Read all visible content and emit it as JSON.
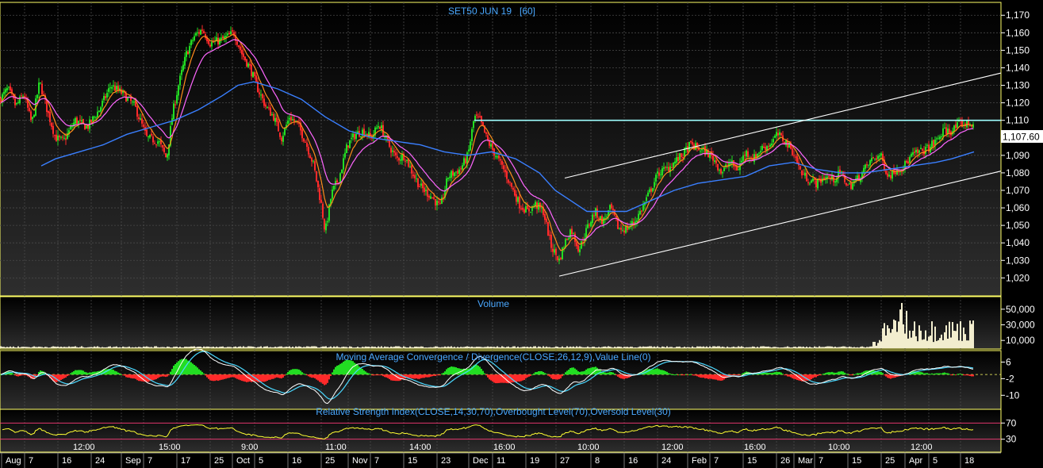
{
  "chart_data": {
    "type": "candlestick",
    "title": "SET50 JUN 19   [60]",
    "last_price_label": "1,107.60",
    "last_price": 1107.6,
    "price_axis": {
      "ylim": [
        1012,
        1176
      ],
      "ticks": [
        {
          "v": 1170,
          "label": "1,170"
        },
        {
          "v": 1160,
          "label": "1,160"
        },
        {
          "v": 1150,
          "label": "1,150"
        },
        {
          "v": 1140,
          "label": "1,140"
        },
        {
          "v": 1130,
          "label": "1,130"
        },
        {
          "v": 1120,
          "label": "1,120"
        },
        {
          "v": 1110,
          "label": "1,110"
        },
        {
          "v": 1090,
          "label": "1,090"
        },
        {
          "v": 1080,
          "label": "1,080"
        },
        {
          "v": 1070,
          "label": "1,070"
        },
        {
          "v": 1060,
          "label": "1,060"
        },
        {
          "v": 1050,
          "label": "1,050"
        },
        {
          "v": 1040,
          "label": "1,040"
        },
        {
          "v": 1030,
          "label": "1,030"
        },
        {
          "v": 1020,
          "label": "1,020"
        }
      ]
    },
    "price_path": [
      [
        0,
        1122
      ],
      [
        10,
        1128
      ],
      [
        20,
        1118
      ],
      [
        30,
        1125
      ],
      [
        40,
        1108
      ],
      [
        50,
        1132
      ],
      [
        60,
        1115
      ],
      [
        70,
        1100
      ],
      [
        80,
        1098
      ],
      [
        95,
        1110
      ],
      [
        110,
        1106
      ],
      [
        125,
        1116
      ],
      [
        140,
        1130
      ],
      [
        155,
        1125
      ],
      [
        170,
        1118
      ],
      [
        185,
        1100
      ],
      [
        200,
        1098
      ],
      [
        210,
        1088
      ],
      [
        218,
        1115
      ],
      [
        225,
        1130
      ],
      [
        235,
        1148
      ],
      [
        245,
        1158
      ],
      [
        255,
        1162
      ],
      [
        265,
        1154
      ],
      [
        280,
        1156
      ],
      [
        295,
        1160
      ],
      [
        305,
        1148
      ],
      [
        315,
        1140
      ],
      [
        325,
        1128
      ],
      [
        335,
        1118
      ],
      [
        345,
        1112
      ],
      [
        355,
        1100
      ],
      [
        365,
        1112
      ],
      [
        375,
        1108
      ],
      [
        385,
        1098
      ],
      [
        395,
        1085
      ],
      [
        405,
        1062
      ],
      [
        410,
        1046
      ],
      [
        418,
        1068
      ],
      [
        428,
        1078
      ],
      [
        438,
        1096
      ],
      [
        448,
        1102
      ],
      [
        458,
        1104
      ],
      [
        468,
        1100
      ],
      [
        478,
        1108
      ],
      [
        490,
        1096
      ],
      [
        500,
        1088
      ],
      [
        510,
        1090
      ],
      [
        520,
        1080
      ],
      [
        530,
        1072
      ],
      [
        545,
        1066
      ],
      [
        555,
        1060
      ],
      [
        565,
        1078
      ],
      [
        580,
        1082
      ],
      [
        590,
        1090
      ],
      [
        598,
        1112
      ],
      [
        605,
        1110
      ],
      [
        615,
        1098
      ],
      [
        625,
        1090
      ],
      [
        635,
        1082
      ],
      [
        645,
        1072
      ],
      [
        655,
        1062
      ],
      [
        665,
        1058
      ],
      [
        675,
        1062
      ],
      [
        685,
        1058
      ],
      [
        695,
        1038
      ],
      [
        705,
        1030
      ],
      [
        712,
        1040
      ],
      [
        720,
        1048
      ],
      [
        730,
        1036
      ],
      [
        740,
        1048
      ],
      [
        750,
        1058
      ],
      [
        760,
        1052
      ],
      [
        770,
        1060
      ],
      [
        780,
        1048
      ],
      [
        790,
        1048
      ],
      [
        800,
        1052
      ],
      [
        810,
        1060
      ],
      [
        820,
        1070
      ],
      [
        830,
        1080
      ],
      [
        840,
        1082
      ],
      [
        850,
        1086
      ],
      [
        860,
        1090
      ],
      [
        870,
        1096
      ],
      [
        880,
        1094
      ],
      [
        890,
        1092
      ],
      [
        900,
        1088
      ],
      [
        910,
        1080
      ],
      [
        920,
        1086
      ],
      [
        930,
        1082
      ],
      [
        940,
        1092
      ],
      [
        950,
        1088
      ],
      [
        960,
        1094
      ],
      [
        970,
        1096
      ],
      [
        980,
        1102
      ],
      [
        990,
        1098
      ],
      [
        1000,
        1092
      ],
      [
        1010,
        1080
      ],
      [
        1020,
        1076
      ],
      [
        1030,
        1074
      ],
      [
        1040,
        1078
      ],
      [
        1050,
        1076
      ],
      [
        1060,
        1080
      ],
      [
        1070,
        1072
      ],
      [
        1080,
        1076
      ],
      [
        1090,
        1082
      ],
      [
        1100,
        1088
      ],
      [
        1110,
        1090
      ],
      [
        1120,
        1078
      ],
      [
        1130,
        1082
      ],
      [
        1140,
        1084
      ],
      [
        1150,
        1090
      ],
      [
        1160,
        1092
      ],
      [
        1170,
        1094
      ],
      [
        1180,
        1098
      ],
      [
        1190,
        1104
      ],
      [
        1200,
        1104
      ],
      [
        1210,
        1108
      ],
      [
        1220,
        1108
      ],
      [
        1228,
        1108
      ]
    ],
    "series": [
      {
        "name": "EMA fast",
        "color": "#ff8c1a"
      },
      {
        "name": "EMA mid",
        "color": "#ff66ff"
      },
      {
        "name": "EMA slow",
        "color": "#3a7fff",
        "path": [
          [
            52,
            1084
          ],
          [
            70,
            1088
          ],
          [
            100,
            1092
          ],
          [
            130,
            1096
          ],
          [
            160,
            1102
          ],
          [
            190,
            1106
          ],
          [
            220,
            1110
          ],
          [
            250,
            1116
          ],
          [
            280,
            1124
          ],
          [
            300,
            1130
          ],
          [
            320,
            1132
          ],
          [
            350,
            1128
          ],
          [
            380,
            1122
          ],
          [
            410,
            1112
          ],
          [
            440,
            1104
          ],
          [
            470,
            1100
          ],
          [
            500,
            1098
          ],
          [
            530,
            1096
          ],
          [
            560,
            1092
          ],
          [
            590,
            1090
          ],
          [
            620,
            1092
          ],
          [
            650,
            1088
          ],
          [
            680,
            1080
          ],
          [
            700,
            1070
          ],
          [
            720,
            1064
          ],
          [
            740,
            1058
          ],
          [
            760,
            1058
          ],
          [
            790,
            1058
          ],
          [
            820,
            1064
          ],
          [
            850,
            1070
          ],
          [
            880,
            1074
          ],
          [
            910,
            1076
          ],
          [
            940,
            1078
          ],
          [
            970,
            1084
          ],
          [
            1000,
            1086
          ],
          [
            1030,
            1082
          ],
          [
            1060,
            1080
          ],
          [
            1090,
            1080
          ],
          [
            1120,
            1082
          ],
          [
            1150,
            1084
          ],
          [
            1180,
            1086
          ],
          [
            1200,
            1088
          ],
          [
            1228,
            1092
          ]
        ]
      }
    ],
    "annotations": {
      "resistance": {
        "value": 1110,
        "x_start": 598,
        "x_end": 1262
      },
      "upper_channel": [
        [
          712,
          1077
        ],
        [
          1262,
          1137
        ]
      ],
      "lower_channel": [
        [
          705,
          1021
        ],
        [
          1262,
          1081
        ]
      ]
    },
    "volume": {
      "title": "Volume",
      "ticks": [
        {
          "v": 50000,
          "label": "50,000"
        },
        {
          "v": 30000,
          "label": "30,000"
        },
        {
          "v": 10000,
          "label": "10,000"
        }
      ],
      "ymax": 62000
    },
    "macd": {
      "title": "Moving Average Convergence / Divergence(CLOSE,26,12,9),Value Line(0)",
      "ticks": [
        {
          "v": 6,
          "label": "6"
        },
        {
          "v": -2,
          "label": "-2"
        },
        {
          "v": -10,
          "label": "-10"
        }
      ],
      "ylim": [
        -16,
        10
      ]
    },
    "rsi": {
      "title": "Relative Strength Index(CLOSE,14,30,70),Overbought Level(70),Oversold Level(30)",
      "ticks": [
        {
          "v": 70,
          "label": "70"
        },
        {
          "v": 30,
          "label": "30"
        }
      ],
      "ylim": [
        0,
        100
      ]
    },
    "x_labels": [
      {
        "x": 7,
        "label": "Aug"
      },
      {
        "x": 36,
        "label": "7"
      },
      {
        "x": 78,
        "label": "16"
      },
      {
        "x": 120,
        "label": "24"
      },
      {
        "x": 158,
        "label": "Sep"
      },
      {
        "x": 186,
        "label": "7"
      },
      {
        "x": 228,
        "label": "17"
      },
      {
        "x": 270,
        "label": "25"
      },
      {
        "x": 298,
        "label": "Oct"
      },
      {
        "x": 326,
        "label": "5"
      },
      {
        "x": 368,
        "label": "16"
      },
      {
        "x": 410,
        "label": "25"
      },
      {
        "x": 444,
        "label": "Nov"
      },
      {
        "x": 472,
        "label": "7"
      },
      {
        "x": 514,
        "label": "15"
      },
      {
        "x": 556,
        "label": "23"
      },
      {
        "x": 596,
        "label": "Dec"
      },
      {
        "x": 626,
        "label": "11"
      },
      {
        "x": 668,
        "label": "19"
      },
      {
        "x": 706,
        "label": "27"
      },
      {
        "x": 750,
        "label": "8"
      },
      {
        "x": 792,
        "label": "16"
      },
      {
        "x": 834,
        "label": "24"
      },
      {
        "x": 872,
        "label": "Feb"
      },
      {
        "x": 900,
        "label": "7"
      },
      {
        "x": 942,
        "label": "15"
      },
      {
        "x": 984,
        "label": "26"
      },
      {
        "x": 1006,
        "label": "Mar"
      },
      {
        "x": 1032,
        "label": "7"
      },
      {
        "x": 1074,
        "label": "15"
      },
      {
        "x": 1116,
        "label": "25"
      },
      {
        "x": 1146,
        "label": "Apr"
      },
      {
        "x": 1176,
        "label": "5"
      },
      {
        "x": 1216,
        "label": "18"
      }
    ],
    "time_labels": [
      {
        "x": 92,
        "label": "12:00"
      },
      {
        "x": 200,
        "label": "15:00"
      },
      {
        "x": 304,
        "label": "9:00"
      },
      {
        "x": 410,
        "label": "11:00"
      },
      {
        "x": 516,
        "label": "14:00"
      },
      {
        "x": 622,
        "label": "16:00"
      },
      {
        "x": 728,
        "label": "10:00"
      },
      {
        "x": 834,
        "label": "12:00"
      },
      {
        "x": 938,
        "label": "16:00"
      },
      {
        "x": 1044,
        "label": "10:00"
      },
      {
        "x": 1148,
        "label": "12:00"
      }
    ],
    "colors": {
      "up": "#22dd22",
      "down": "#ff2a2a",
      "grid": "#4a4a4a",
      "panel_border": "#ffff66",
      "title": "#4aa8ff",
      "resistance": "#9fffff",
      "channel": "#ffffff",
      "volume": "#f2edce",
      "macd_line": "#ffffff",
      "macd_signal": "#4ad8ff",
      "rsi": "#ffff33",
      "rsi_level": "#ff3b7a"
    }
  }
}
